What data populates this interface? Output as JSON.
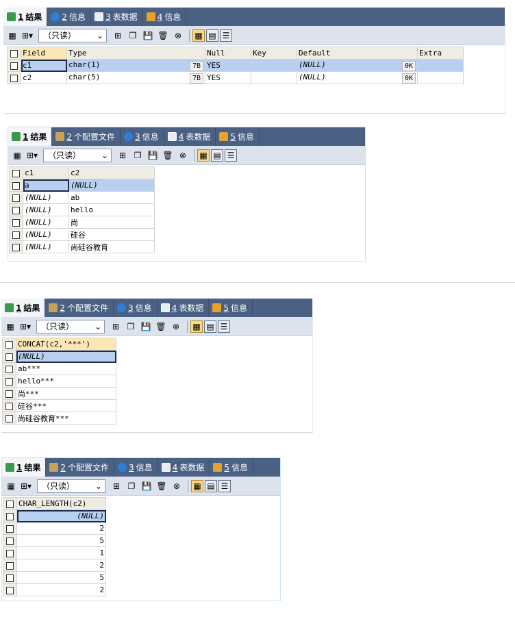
{
  "panels": [
    {
      "tabs": [
        {
          "num": "1",
          "label": "结果",
          "icon": "grid-result-icon",
          "active": true
        },
        {
          "num": "2",
          "label": "信息",
          "icon": "info-icon"
        },
        {
          "num": "3",
          "label": "表数据",
          "icon": "table-data-icon"
        },
        {
          "num": "4",
          "label": "信息",
          "icon": "history-info-icon"
        }
      ],
      "dropdown": "（只读）",
      "columns": [
        "Field",
        "Type",
        "Null",
        "Key",
        "Default",
        "Extra"
      ],
      "rows": [
        [
          "c1",
          "char(1)",
          "7B",
          "YES",
          "",
          "(NULL)",
          "0K",
          ""
        ],
        [
          "c2",
          "char(5)",
          "7B",
          "YES",
          "",
          "(NULL)",
          "0K",
          ""
        ]
      ]
    },
    {
      "tabs": [
        {
          "num": "1",
          "label": "结果",
          "icon": "grid-result-icon",
          "active": true
        },
        {
          "num": "2",
          "label": "个配置文件",
          "icon": "profile-icon"
        },
        {
          "num": "3",
          "label": "信息",
          "icon": "info-icon"
        },
        {
          "num": "4",
          "label": "表数据",
          "icon": "table-data-icon"
        },
        {
          "num": "5",
          "label": "信息",
          "icon": "history-info-icon"
        }
      ],
      "dropdown": "（只读）",
      "columns": [
        "c1",
        "c2"
      ],
      "rows": [
        [
          "a",
          "(NULL)"
        ],
        [
          "(NULL)",
          "ab"
        ],
        [
          "(NULL)",
          "hello"
        ],
        [
          "(NULL)",
          "尚"
        ],
        [
          "(NULL)",
          "硅谷"
        ],
        [
          "(NULL)",
          "尚硅谷教育"
        ]
      ]
    },
    {
      "tabs": [
        {
          "num": "1",
          "label": "结果",
          "icon": "grid-result-icon",
          "active": true
        },
        {
          "num": "2",
          "label": "个配置文件",
          "icon": "profile-icon"
        },
        {
          "num": "3",
          "label": "信息",
          "icon": "info-icon"
        },
        {
          "num": "4",
          "label": "表数据",
          "icon": "table-data-icon"
        },
        {
          "num": "5",
          "label": "信息",
          "icon": "history-info-icon"
        }
      ],
      "dropdown": "（只读）",
      "columns": [
        "CONCAT(c2,'***')"
      ],
      "rows": [
        [
          "(NULL)"
        ],
        [
          "ab***"
        ],
        [
          "hello***"
        ],
        [
          "尚***"
        ],
        [
          "硅谷***"
        ],
        [
          "尚硅谷教育***"
        ]
      ]
    },
    {
      "tabs": [
        {
          "num": "1",
          "label": "结果",
          "icon": "grid-result-icon",
          "active": true
        },
        {
          "num": "2",
          "label": "个配置文件",
          "icon": "profile-icon"
        },
        {
          "num": "3",
          "label": "信息",
          "icon": "info-icon"
        },
        {
          "num": "4",
          "label": "表数据",
          "icon": "table-data-icon"
        },
        {
          "num": "5",
          "label": "信息",
          "icon": "history-info-icon"
        }
      ],
      "dropdown": "（只读）",
      "columns": [
        "CHAR_LENGTH(c2)"
      ],
      "rows": [
        [
          "(NULL)"
        ],
        [
          "2"
        ],
        [
          "5"
        ],
        [
          "1"
        ],
        [
          "2"
        ],
        [
          "5"
        ],
        [
          "2"
        ]
      ]
    }
  ]
}
